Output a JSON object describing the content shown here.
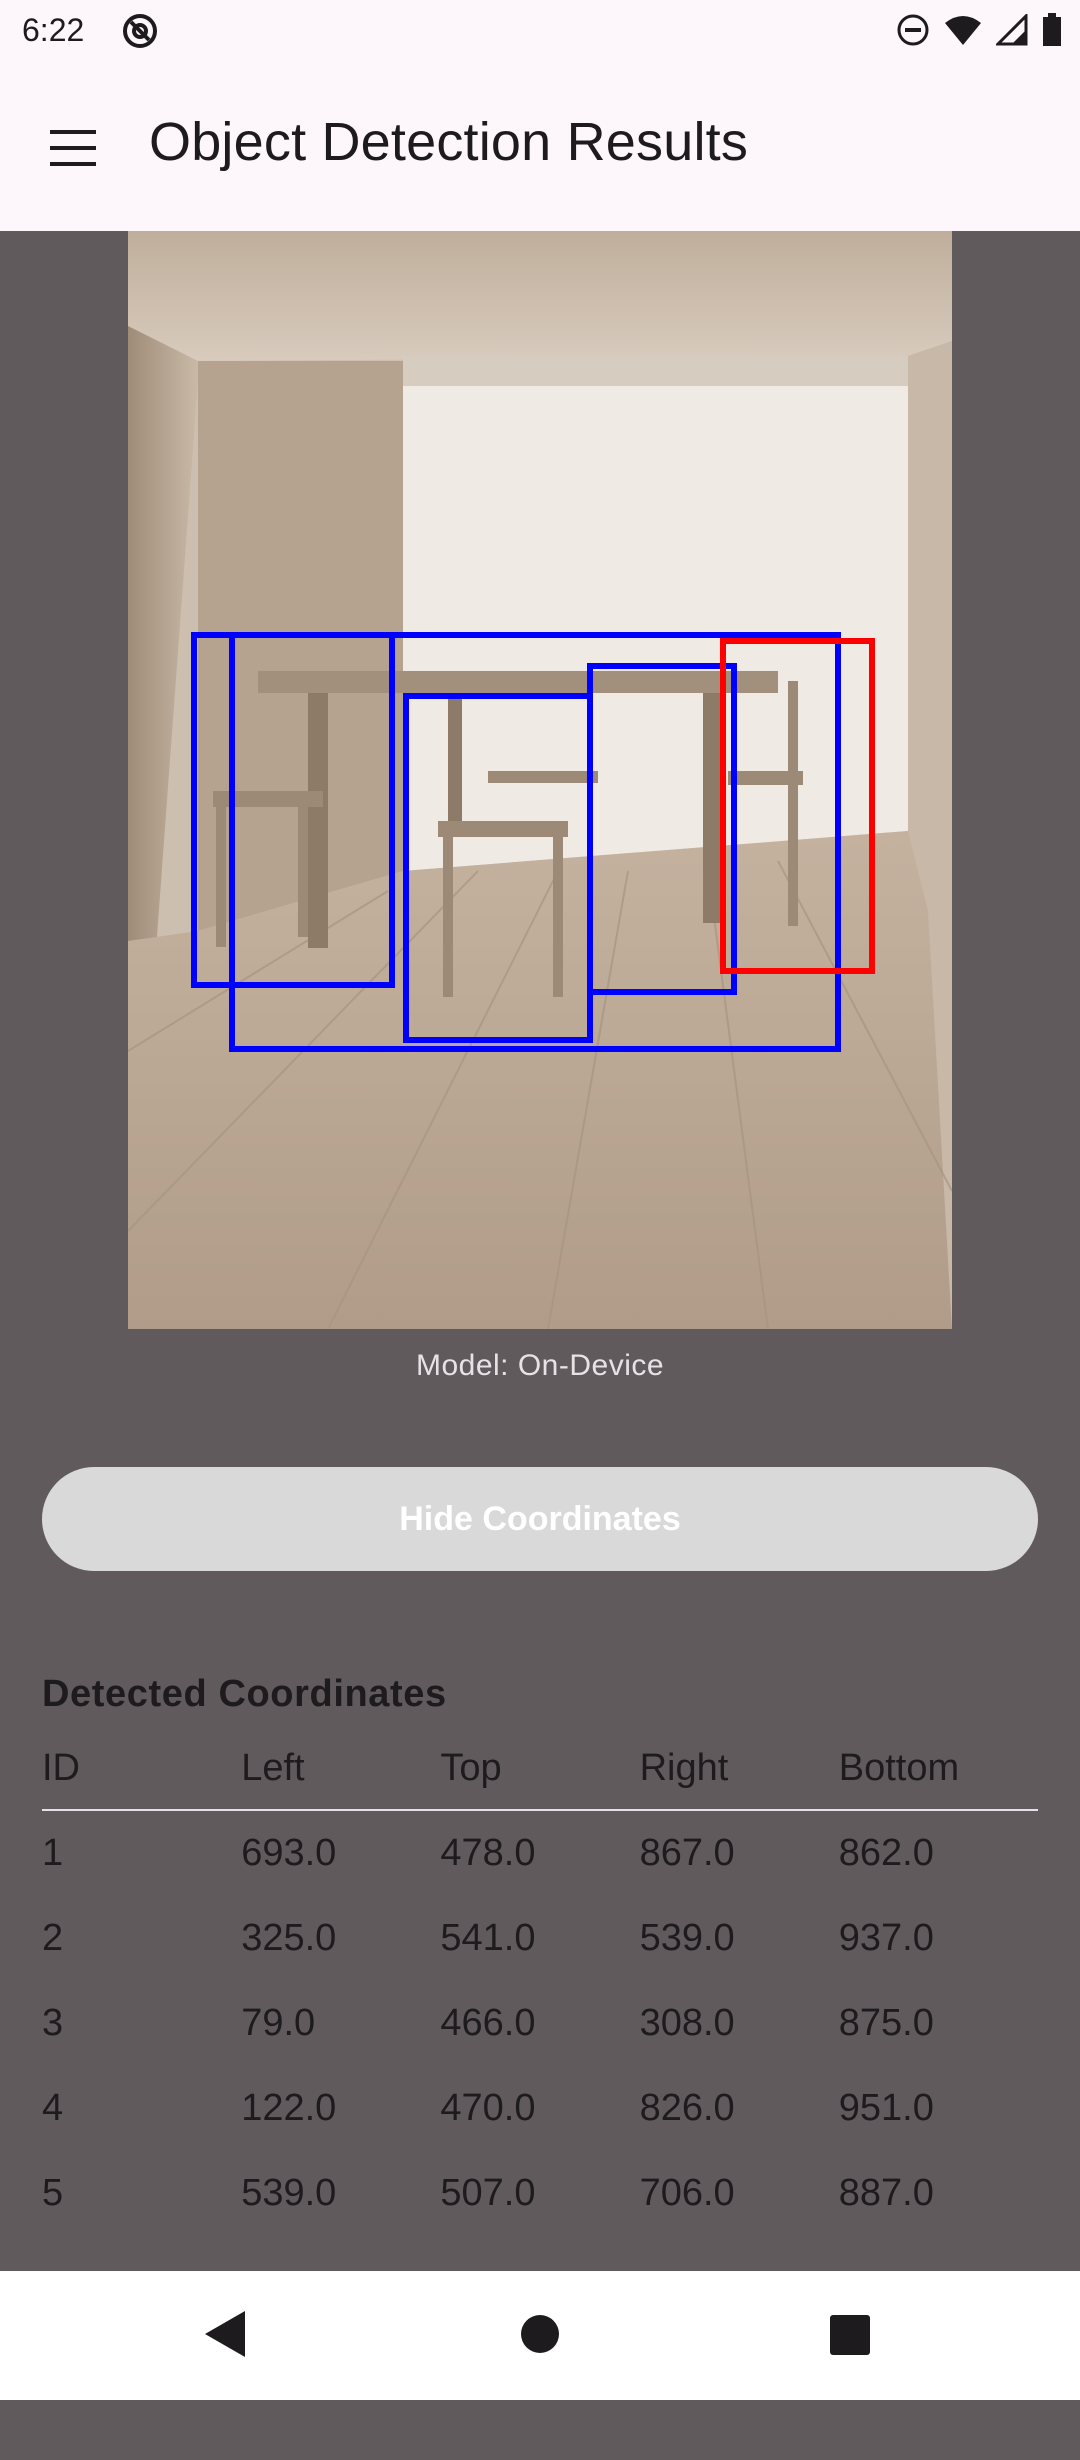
{
  "status_bar": {
    "time": "6:22",
    "left_icon": "at-sign-icon",
    "right_icons": [
      "do-not-disturb-icon",
      "wifi-icon",
      "signal-icon",
      "battery-icon"
    ]
  },
  "app_bar": {
    "menu_icon": "menu-icon",
    "title": "Object Detection Results"
  },
  "detection": {
    "model_label": "Model: On-Device",
    "box_colors": [
      "#0000ff",
      "#ff0000"
    ]
  },
  "hide_button": {
    "label": "Hide Coordinates"
  },
  "coordinates": {
    "title": "Detected Coordinates",
    "columns": [
      "ID",
      "Left",
      "Top",
      "Right",
      "Bottom"
    ],
    "rows": [
      [
        "1",
        "693.0",
        "478.0",
        "867.0",
        "862.0"
      ],
      [
        "2",
        "325.0",
        "541.0",
        "539.0",
        "937.0"
      ],
      [
        "3",
        "79.0",
        "466.0",
        "308.0",
        "875.0"
      ],
      [
        "4",
        "122.0",
        "470.0",
        "826.0",
        "951.0"
      ],
      [
        "5",
        "539.0",
        "507.0",
        "706.0",
        "887.0"
      ]
    ]
  },
  "nav_bar": {
    "icons": [
      "back-icon",
      "home-icon",
      "recents-icon"
    ]
  }
}
